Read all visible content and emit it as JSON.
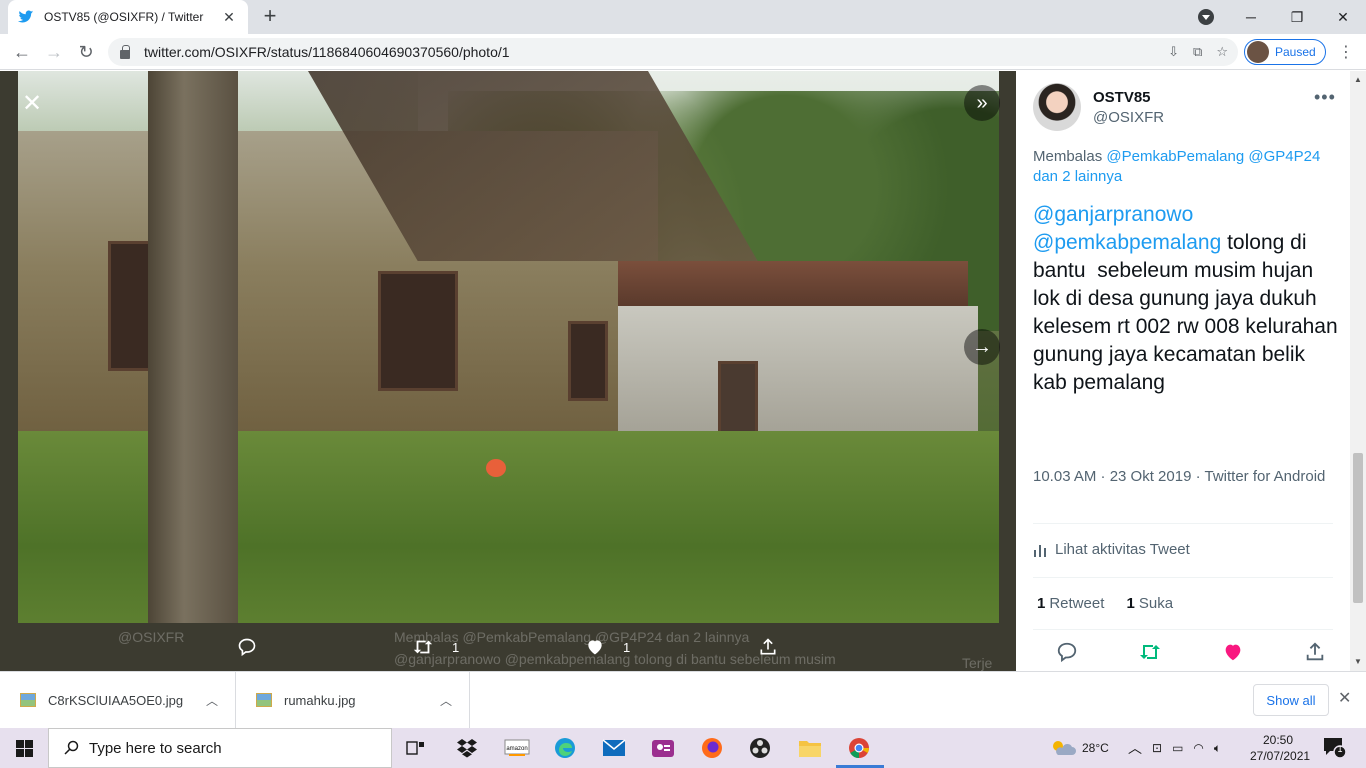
{
  "browser": {
    "tab_title": "OSTV85 (@OSIXFR) / Twitter",
    "url": "twitter.com/OSIXFR/status/1186840604690370560/photo/1",
    "profile_status": "Paused",
    "accent_color": "#1a73e8"
  },
  "media": {
    "ghost_handle": "@OSIXFR",
    "ghost_reply": "Membalas @PemkabPemalang @GP4P24 dan 2 lainnya",
    "ghost_text": "@ganjarpranowo @pemkabpemalang tolong di bantu sebeleum musim",
    "ghost_right": "Terje",
    "retweet_count": "1",
    "like_count": "1"
  },
  "tweet": {
    "author_name": "OSTV85",
    "author_handle": "@OSIXFR",
    "reply_prefix": "Membalas",
    "reply_mention_1": "@PemkabPemalang",
    "reply_mention_2": "@GP4P24",
    "reply_others": "dan 2 lainnya",
    "mention_1": "@ganjarpranowo",
    "mention_2": "@pemkabpemalang",
    "text_after_mentions": " tolong di bantu  sebeleum musim hujan\nlok di desa gunung jaya dukuh kelesem rt 002 rw 008 kelurahan gunung jaya kecamatan belik  kab pemalang",
    "timestamp": "10.03 AM · 23 Okt 2019 · Twitter for Android",
    "activity_label": "Lihat aktivitas Tweet",
    "retweets_count": "1",
    "retweets_label": "Retweet",
    "likes_count": "1",
    "likes_label": "Suka",
    "link_color": "#1d9bf0",
    "like_color": "#f91880",
    "retweet_color": "#00ba7c"
  },
  "downloads": {
    "items": [
      {
        "name": "C8rKSClUIAA5OE0.jpg"
      },
      {
        "name": "rumahku.jpg"
      }
    ],
    "show_all": "Show all"
  },
  "taskbar": {
    "search_placeholder": "Type here to search",
    "weather": "28°C",
    "time": "20:50",
    "date": "27/07/2021",
    "notification_count": "1"
  }
}
